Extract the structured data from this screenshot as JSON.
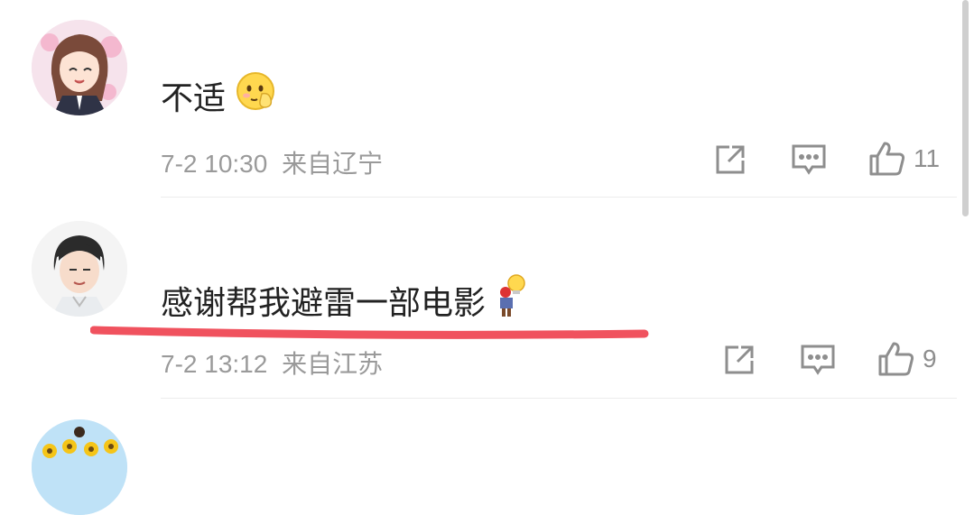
{
  "comments": [
    {
      "text": "不适",
      "emoji": "emoji-shy",
      "timestamp": "7-2 10:30",
      "location": "来自辽宁",
      "like_count": "11"
    },
    {
      "text": "感谢帮我避雷一部电影",
      "emoji": "emoji-bulb-person",
      "timestamp": "7-2 13:12",
      "location": "来自江苏",
      "like_count": "9"
    }
  ],
  "colors": {
    "underline": "#f0525e",
    "meta_text": "#9a9a9a",
    "icon": "#8e8e8e"
  }
}
